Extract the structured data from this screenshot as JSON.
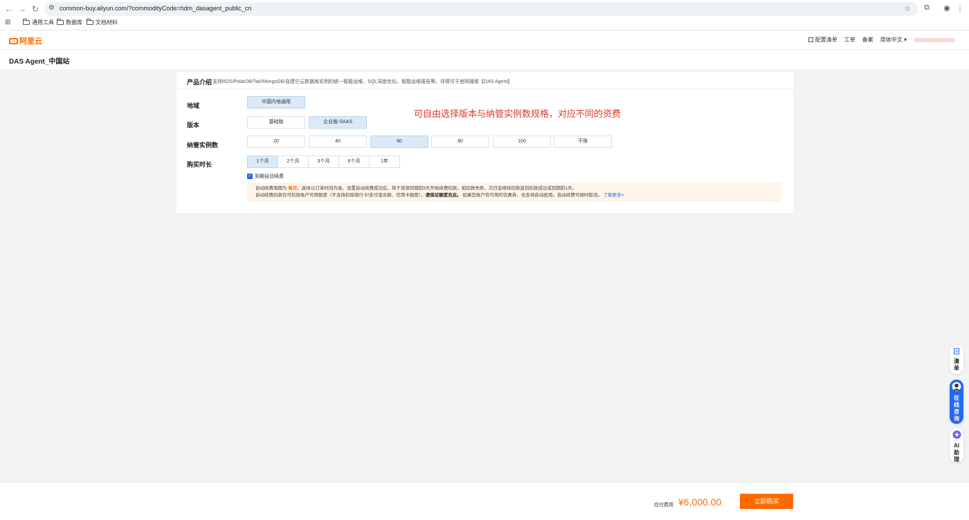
{
  "browser": {
    "url": "common-buy.aliyun.com/?commodityCode=hdm_dasagent_public_cn",
    "bookmarks": [
      "通用工具",
      "数据库",
      "文档材料"
    ]
  },
  "header": {
    "logo": "阿里云",
    "nav": {
      "config_list": "配置清单",
      "ticket": "工单",
      "filing": "备案",
      "language": "简体中文"
    }
  },
  "page": {
    "title": "DAS Agent_中国站"
  },
  "intro": {
    "label": "产品介绍",
    "desc": "支持RDS/PolarDB/Tair/MongoDB/自建它云数据库实例的统一智能运维、SQL深度优化、智能运维报告等。详情可于官网搜索【DAS Agent】"
  },
  "form": {
    "region": {
      "label": "地域",
      "options": [
        "中国内地通用"
      ],
      "selected": 0
    },
    "version": {
      "label": "版本",
      "options": [
        "基础版",
        "企业版-SAAS"
      ],
      "selected": 1
    },
    "instances": {
      "label": "纳管实例数",
      "options": [
        "20",
        "40",
        "60",
        "80",
        "100",
        "不限"
      ],
      "selected": 2
    },
    "duration": {
      "label": "购买时长",
      "options": [
        "1个月",
        "2个月",
        "3个月",
        "6个月",
        "1年"
      ],
      "selected": 0
    },
    "auto_renew": {
      "label": "到期自动续费",
      "checked": true
    },
    "annotation": "可自由选择版本与纳管实例数规格，对应不同的资费"
  },
  "tip": {
    "l1_a": "自动续费周期为",
    "l1_b": "每月",
    "l1_c": "，具体以订单时间为准，设置自动续费成功后，将于资源到期前9天开始续费扣款，如扣款失败，次日会继续扣款直到扣款成功或到期前1天。",
    "l2_a": "自动续费扣款仅可扣除账户可用额度（不支持扣除银行卡/支付宝余额、信用卡额度），",
    "l2_b": "请保证额度充足。",
    "l2_c": "如果您账户有可用的优惠券，也支持自动抵用。自动续费可随时取消。",
    "l2_link": "了解更多>"
  },
  "float": {
    "cart": "清单",
    "consult": "在线咨询",
    "ai": "AI助理"
  },
  "footer": {
    "fee_label": "应付费用",
    "fee_value": "¥6,000.00",
    "buy": "立即购买"
  },
  "colors": {
    "accent": "#ff6a00",
    "selected_bg": "#dceaf7",
    "annotation": "#e0342b",
    "link": "#2468f2"
  }
}
